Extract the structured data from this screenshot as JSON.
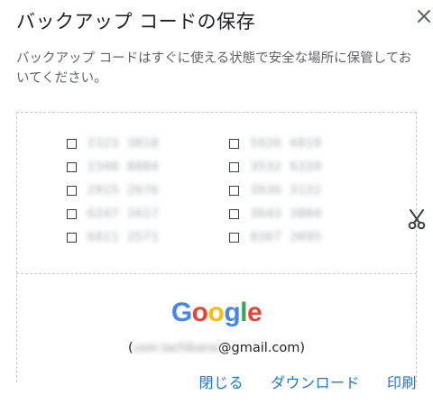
{
  "dialog": {
    "title": "バックアップ コードの保存",
    "description": "バックアップ コードはすぐに使える状態で安全な場所に保管しておいてください。",
    "close_icon": "close-icon"
  },
  "codes": {
    "left": [
      "2323 3818",
      "2340 8884",
      "2915 2676",
      "6247 1617",
      "6811 2571"
    ],
    "right": [
      "5926 6819",
      "3532 6339",
      "3936 3132",
      "3643 3804",
      "8367 2095"
    ]
  },
  "card": {
    "scissors_icon": "scissors-icon",
    "logo": {
      "letters": [
        "G",
        "o",
        "o",
        "g",
        "l",
        "e"
      ],
      "colors": [
        "#4285f4",
        "#ea4335",
        "#fbbc05",
        "#4285f4",
        "#34a853",
        "#ea4335"
      ]
    },
    "account": {
      "open": "(",
      "masked_user": "user.tachibana",
      "domain": "@gmail.com)"
    }
  },
  "actions": {
    "close": "閉じる",
    "download": "ダウンロード",
    "print": "印刷"
  },
  "colors": {
    "accent": "#1a73e8"
  }
}
